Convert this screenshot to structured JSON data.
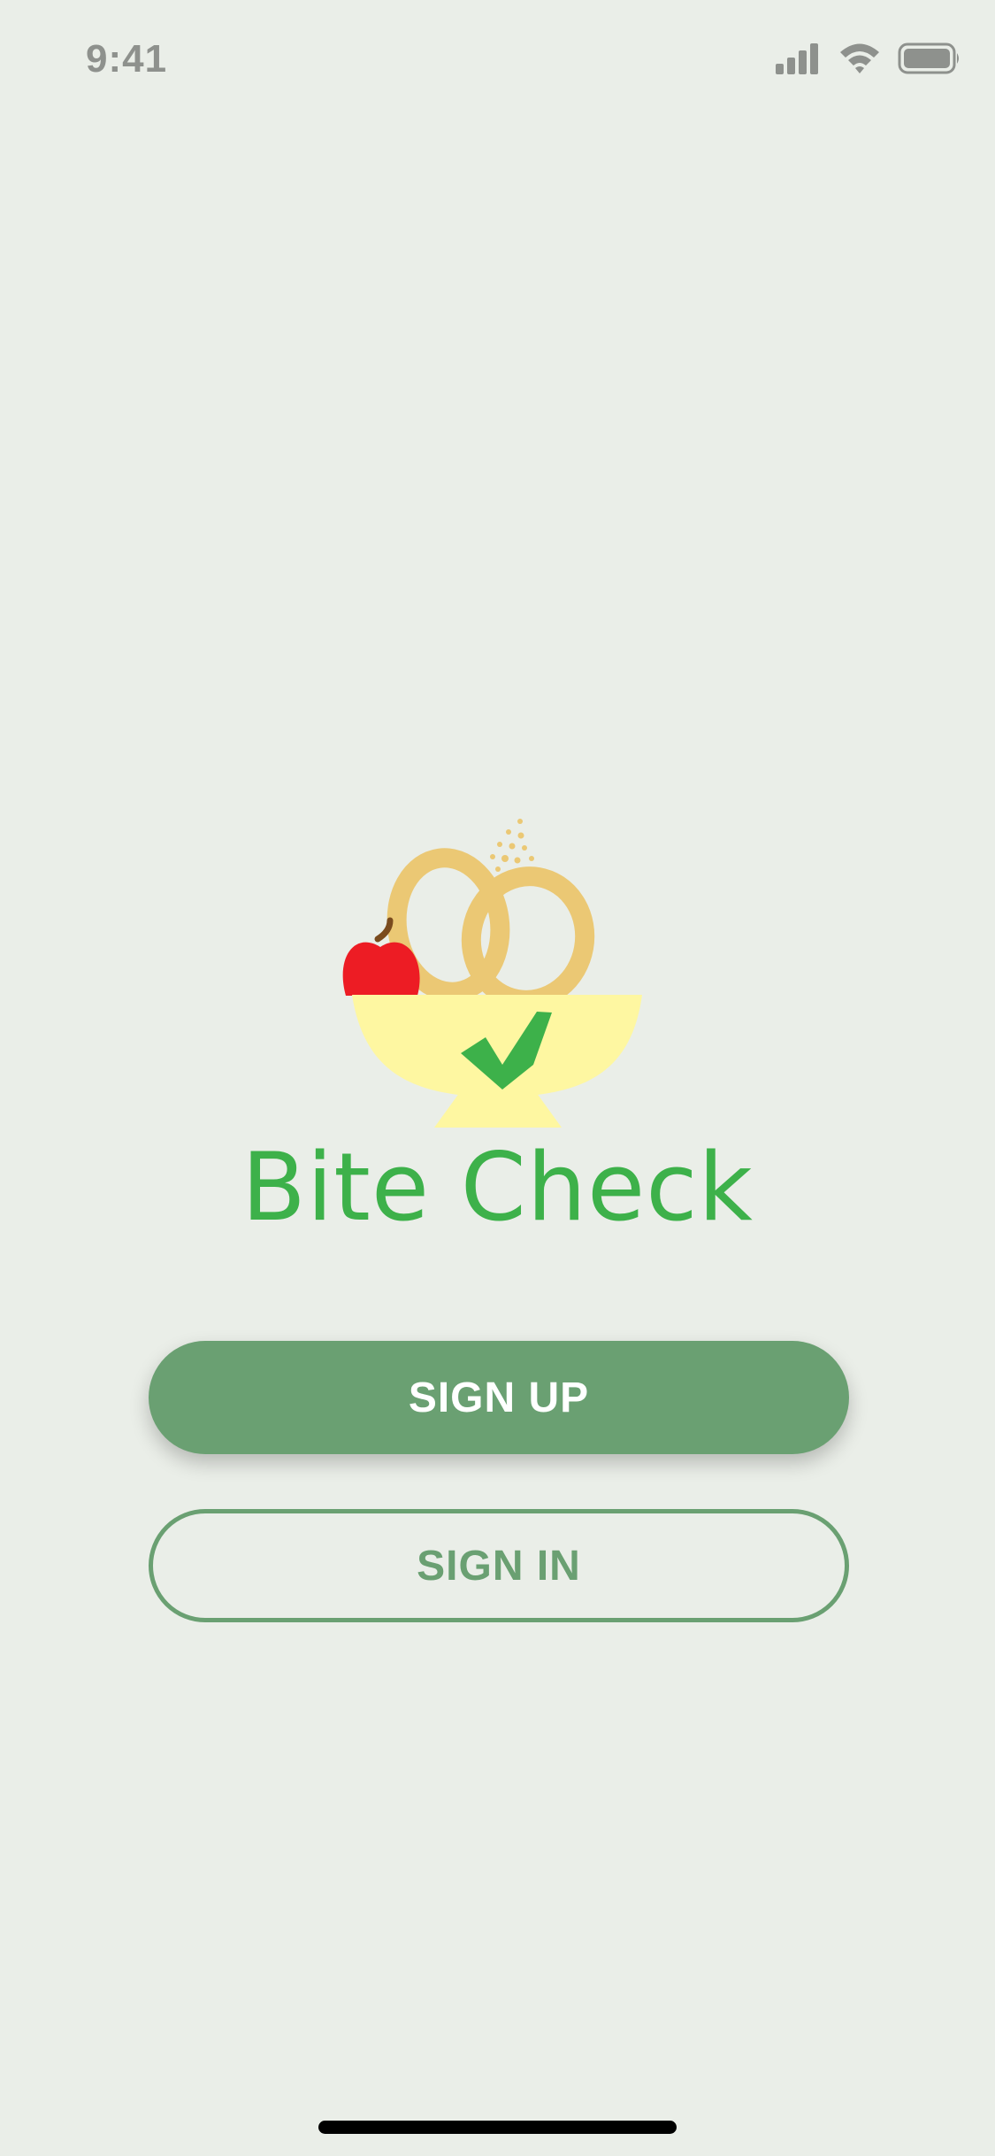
{
  "status_bar": {
    "time": "9:41",
    "icons": [
      "signal-icon",
      "wifi-icon",
      "battery-icon"
    ]
  },
  "brand": {
    "name": "Bite Check",
    "logo": "bowl-with-apple-pretzel-and-checkmark",
    "color": "#3db14a"
  },
  "actions": {
    "sign_up_label": "SIGN UP",
    "sign_in_label": "SIGN IN"
  },
  "colors": {
    "background": "#eaeee8",
    "primary": "#6aa072",
    "apple": "#ed1c24",
    "bowl": "#fef7a1",
    "pretzel": "#ebc874",
    "check": "#3db14a"
  }
}
